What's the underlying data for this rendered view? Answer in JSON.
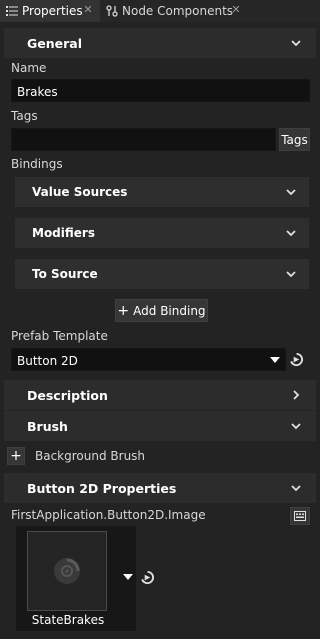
{
  "tabs": [
    {
      "label": "Properties",
      "icon": "list-icon"
    },
    {
      "label": "Node Components",
      "icon": "components-icon"
    }
  ],
  "sections": {
    "general": "General",
    "description": "Description",
    "brush": "Brush",
    "button2d": "Button 2D Properties"
  },
  "name": {
    "label": "Name",
    "value": "Brakes"
  },
  "tags": {
    "label": "Tags",
    "value": "",
    "button": "Tags"
  },
  "bindings": {
    "label": "Bindings",
    "subsections": [
      "Value Sources",
      "Modifiers",
      "To Source"
    ],
    "add_button": "Add Binding"
  },
  "prefab": {
    "label": "Prefab Template",
    "value": "Button 2D"
  },
  "brush": {
    "item_label": "Background Brush"
  },
  "image_property": {
    "label": "FirstApplication.Button2D.Image",
    "value": "StateBrakes"
  },
  "colors": {
    "background": "#232323",
    "header": "#2c2c2c",
    "field": "#111111"
  }
}
